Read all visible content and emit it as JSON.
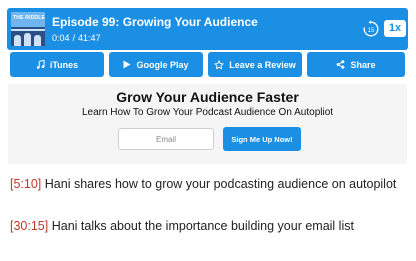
{
  "player": {
    "cover": {
      "brand_text": "THE RIDDLE"
    },
    "episode_title": "Episode 99: Growing Your Audience",
    "current_time": "0:04",
    "separator": "/",
    "duration": "41:47",
    "skip_seconds": "15",
    "speed": "1x",
    "accent_color": "#1a8fe3"
  },
  "subscribe": [
    {
      "label": "iTunes",
      "icon": "music-note-icon"
    },
    {
      "label": "Google Play",
      "icon": "play-icon"
    },
    {
      "label": "Leave a Review",
      "icon": "star-icon"
    },
    {
      "label": "Share",
      "icon": "share-icon"
    }
  ],
  "optin": {
    "title": "Grow Your Audience Faster",
    "subtitle": "Learn How To Grow Your Podcast Audience On Autopliot",
    "email_placeholder": "Email",
    "button_label": "Sign Me Up Now!"
  },
  "timestamps": [
    {
      "time": "[5:10]",
      "text": "Hani shares how to grow your podcasting audience on autopilot"
    },
    {
      "time": "[30:15]",
      "text": "Hani talks about the importance building your email list"
    }
  ],
  "colors": {
    "link": "#c0392b",
    "panel_bg": "#f5f5f5"
  }
}
